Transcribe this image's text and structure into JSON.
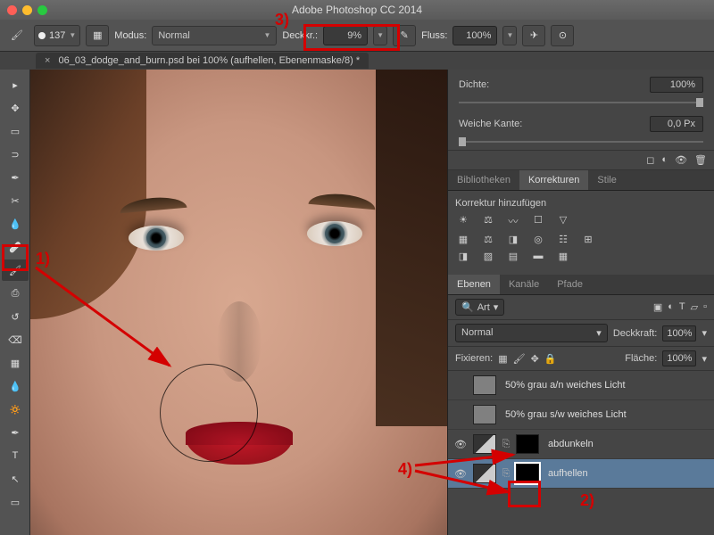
{
  "app_title": "Adobe Photoshop CC 2014",
  "doc_tab": "06_03_dodge_and_burn.psd bei 100% (aufhellen, Ebenenmaske/8) *",
  "option_bar": {
    "brush_size": "137",
    "mode_label": "Modus:",
    "mode_value": "Normal",
    "opacity_label": "Deckkr.:",
    "opacity_value": "9%",
    "flow_label": "Fluss:",
    "flow_value": "100%"
  },
  "properties": {
    "density_label": "Dichte:",
    "density_value": "100%",
    "feather_label": "Weiche Kante:",
    "feather_value": "0,0 Px"
  },
  "panel_tabs1": {
    "lib": "Bibliotheken",
    "corr": "Korrekturen",
    "style": "Stile"
  },
  "corrections_add": "Korrektur hinzufügen",
  "panel_tabs2": {
    "layers": "Ebenen",
    "channels": "Kanäle",
    "paths": "Pfade"
  },
  "layer_opts": {
    "kind": "Art",
    "mode": "Normal",
    "opacity_label": "Deckkraft:",
    "opacity_value": "100%",
    "lock_label": "Fixieren:",
    "fill_label": "Fläche:",
    "fill_value": "100%"
  },
  "layers": [
    {
      "name": "50% grau a/n weiches Licht",
      "thumb": "t-gray",
      "mask": "",
      "vis": ""
    },
    {
      "name": "50% grau s/w weiches Licht",
      "thumb": "t-gray",
      "mask": "",
      "vis": ""
    },
    {
      "name": "abdunkeln",
      "thumb": "t-adj",
      "mask": "t-black",
      "vis": "👁"
    },
    {
      "name": "aufhellen",
      "thumb": "t-adj",
      "mask": "t-black",
      "vis": "👁",
      "selected": true
    }
  ],
  "annotations": {
    "a1": "1)",
    "a2": "2)",
    "a3": "3)",
    "a4": "4)"
  },
  "tools": [
    "↖",
    "▭",
    "◯",
    "✎",
    "✂",
    "✐",
    "⚕",
    "✍",
    "⎙",
    "⊕",
    "◧",
    "⌀",
    "◔",
    "⬚",
    "✒",
    "T",
    "▹",
    "✋",
    "🔍"
  ]
}
